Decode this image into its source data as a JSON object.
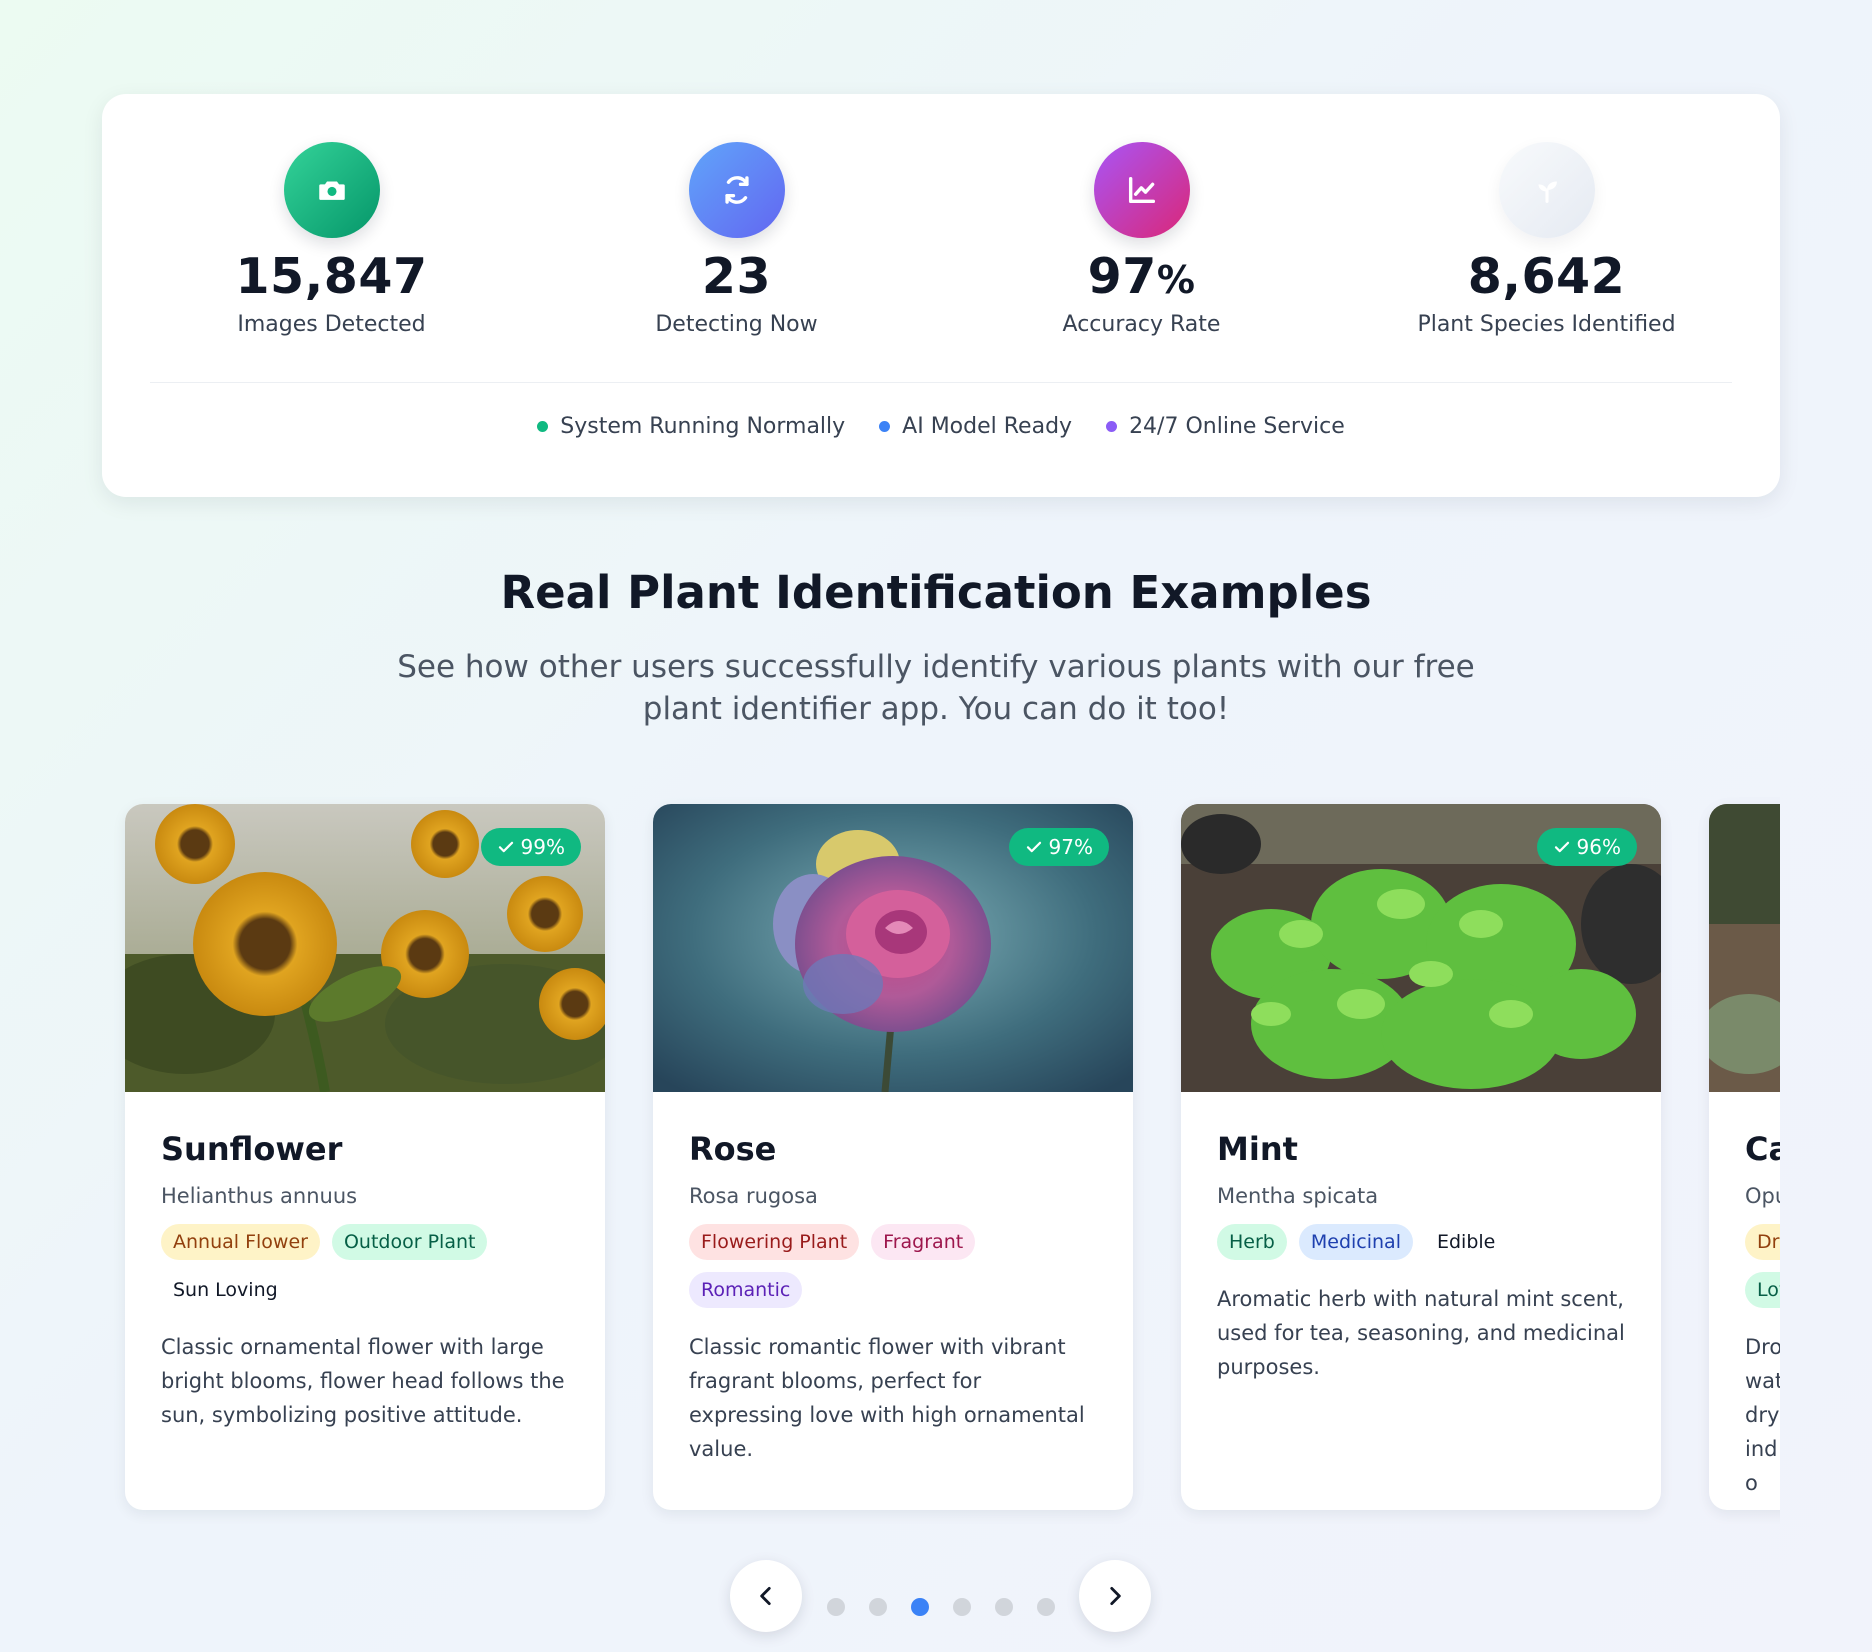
{
  "stats": [
    {
      "value": "15,847",
      "unit": "",
      "label": "Images Detected",
      "icon": "camera-icon",
      "color_start": "#34d399",
      "color_end": "#059669"
    },
    {
      "value": "23",
      "unit": "",
      "label": "Detecting Now",
      "icon": "refresh-icon",
      "color_start": "#60a5fa",
      "color_end": "#6366f1"
    },
    {
      "value": "97",
      "unit": "%",
      "label": "Accuracy Rate",
      "icon": "chart-line-icon",
      "color_start": "#a855f7",
      "color_end": "#db2777"
    },
    {
      "value": "8,642",
      "unit": "",
      "label": "Plant Species Identified",
      "icon": "sprout-icon",
      "color_start": "#f1f5f9",
      "color_end": "#e5eaf2"
    }
  ],
  "status": [
    {
      "label": "System Running Normally",
      "color": "#10b981"
    },
    {
      "label": "AI Model Ready",
      "color": "#3b82f6"
    },
    {
      "label": "24/7 Online Service",
      "color": "#8b5cf6"
    }
  ],
  "section": {
    "title": "Real Plant Identification Examples",
    "subtitle": "See how other users successfully identify various plants with our free plant identifier app. You can do it too!"
  },
  "cards": [
    {
      "name": "Sunflower",
      "scientific": "Helianthus annuus",
      "confidence": "99%",
      "tags": [
        {
          "label": "Annual Flower",
          "bg": "#fef3c7",
          "fg": "#92400e"
        },
        {
          "label": "Outdoor Plant",
          "bg": "#d1fae5",
          "fg": "#065f46"
        },
        {
          "label": "Sun Loving",
          "bg": "transparent",
          "fg": "#111827"
        }
      ],
      "description": "Classic ornamental flower with large bright blooms, flower head follows the sun, symbolizing positive attitude."
    },
    {
      "name": "Rose",
      "scientific": "Rosa rugosa",
      "confidence": "97%",
      "tags": [
        {
          "label": "Flowering Plant",
          "bg": "#fee2e2",
          "fg": "#991b1b"
        },
        {
          "label": "Fragrant",
          "bg": "#fce7f3",
          "fg": "#9d174d"
        },
        {
          "label": "Romantic",
          "bg": "#ede9fe",
          "fg": "#5b21b6"
        }
      ],
      "description": "Classic romantic flower with vibrant fragrant blooms, perfect for expressing love with high ornamental value."
    },
    {
      "name": "Mint",
      "scientific": "Mentha spicata",
      "confidence": "96%",
      "tags": [
        {
          "label": "Herb",
          "bg": "#d1fae5",
          "fg": "#065f46"
        },
        {
          "label": "Medicinal",
          "bg": "#dbeafe",
          "fg": "#1e40af"
        },
        {
          "label": "Edible",
          "bg": "transparent",
          "fg": "#111827"
        }
      ],
      "description": "Aromatic herb with natural mint scent, used for tea, seasoning, and medicinal purposes."
    },
    {
      "name": "Ca",
      "scientific": "Opu",
      "tags": [
        {
          "label": "Dro",
          "bg": "#fef3c7",
          "fg": "#92400e"
        },
        {
          "label": "Lov",
          "bg": "#d1fae5",
          "fg": "#065f46"
        }
      ],
      "description": "Dro wat dry indo"
    }
  ],
  "pagination": {
    "total": 6,
    "active": 2
  },
  "nav": {
    "prev_icon": "chevron-left-icon",
    "next_icon": "chevron-right-icon"
  }
}
